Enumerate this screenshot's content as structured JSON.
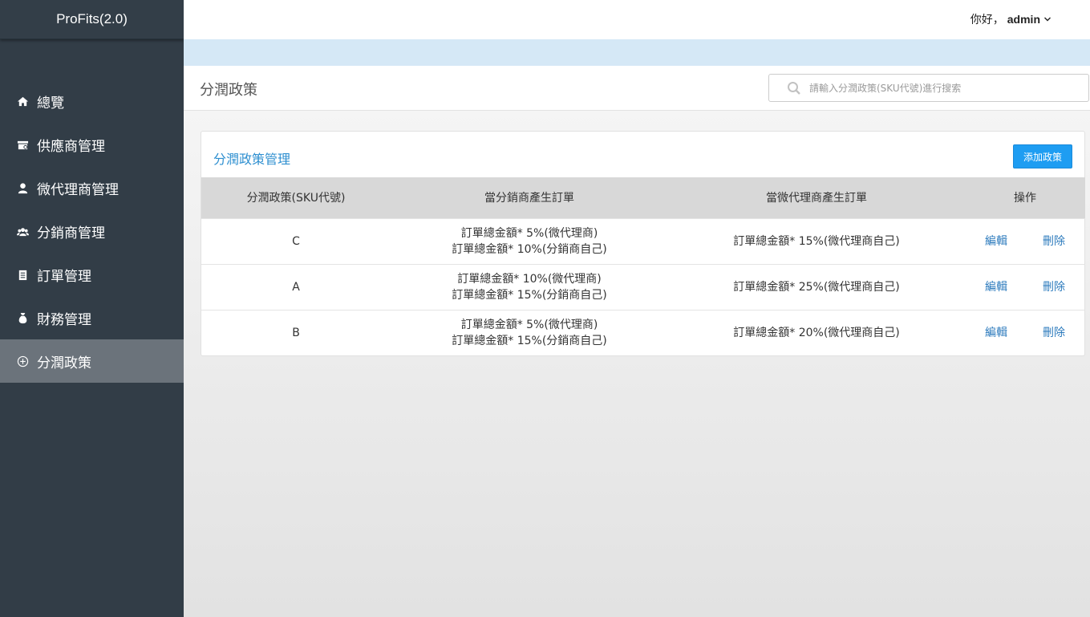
{
  "brand": "ProFits(2.0)",
  "nav": [
    {
      "label": "總覽",
      "icon": "home-icon"
    },
    {
      "label": "供應商管理",
      "icon": "store-icon"
    },
    {
      "label": "微代理商管理",
      "icon": "user-icon"
    },
    {
      "label": "分銷商管理",
      "icon": "users-icon"
    },
    {
      "label": "訂單管理",
      "icon": "clipboard-icon"
    },
    {
      "label": "財務管理",
      "icon": "money-bag-icon"
    },
    {
      "label": "分潤政策",
      "icon": "circle-plus-icon",
      "active": true
    }
  ],
  "topbar": {
    "greeting": "你好，",
    "username": "admin"
  },
  "page": {
    "title": "分潤政策",
    "search_placeholder": "請輸入分潤政策(SKU代號)進行搜索"
  },
  "panel": {
    "title": "分潤政策管理",
    "add_label": "添加政策"
  },
  "table": {
    "headers": [
      "分潤政策(SKU代號)",
      "當分銷商產生訂單",
      "當微代理商產生訂單",
      "操作"
    ],
    "rows": [
      {
        "sku": "C",
        "dist_line1": "訂單總金額* 5%(微代理商)",
        "dist_line2": "訂單總金額* 10%(分銷商自己)",
        "micro": "訂單總金額* 15%(微代理商自己)",
        "edit": "編輯",
        "delete": "刪除"
      },
      {
        "sku": "A",
        "dist_line1": "訂單總金額* 10%(微代理商)",
        "dist_line2": "訂單總金額* 15%(分銷商自己)",
        "micro": "訂單總金額* 25%(微代理商自己)",
        "edit": "編輯",
        "delete": "刪除"
      },
      {
        "sku": "B",
        "dist_line1": "訂單總金額* 5%(微代理商)",
        "dist_line2": "訂單總金額* 15%(分銷商自己)",
        "micro": "訂單總金額* 20%(微代理商自己)",
        "edit": "編輯",
        "delete": "刪除"
      }
    ]
  },
  "colors": {
    "sidebar": "#323d47",
    "active": "#6b737b",
    "accent": "#1e9df2",
    "link": "#2d7bbd",
    "band": "#d5e8f6"
  }
}
